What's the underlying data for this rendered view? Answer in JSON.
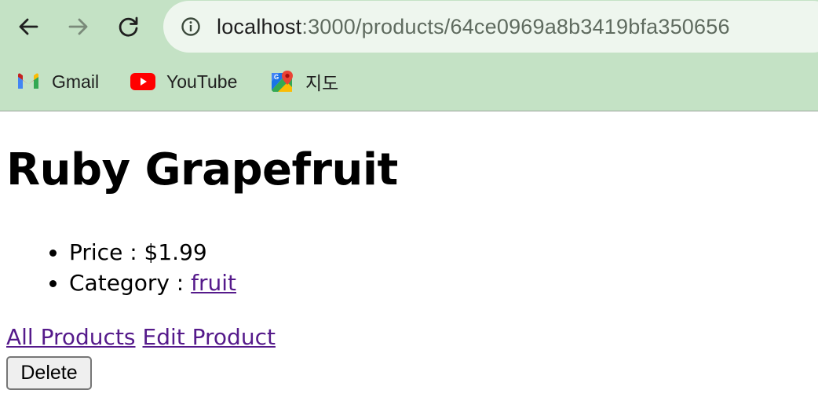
{
  "browser": {
    "url_host": "localhost",
    "url_path": ":3000/products/64ce0969a8b3419bfa350656",
    "bookmarks": [
      {
        "label": "Gmail",
        "icon": "gmail-icon"
      },
      {
        "label": "YouTube",
        "icon": "youtube-icon"
      },
      {
        "label": "지도",
        "icon": "maps-icon"
      }
    ],
    "nav_icons": [
      "back-arrow-icon",
      "forward-arrow-icon",
      "reload-icon",
      "info-icon"
    ],
    "colors": {
      "toolbar": "#c4e2c5",
      "omnibox": "#eef6ee",
      "visited_link": "#551a8b"
    }
  },
  "product": {
    "title": "Ruby Grapefruit",
    "price_label": "Price : $1.99",
    "category_prefix": "Category : ",
    "category_link": "fruit"
  },
  "actions": {
    "all_products": "All Products",
    "edit_product": "Edit Product",
    "delete": "Delete"
  }
}
